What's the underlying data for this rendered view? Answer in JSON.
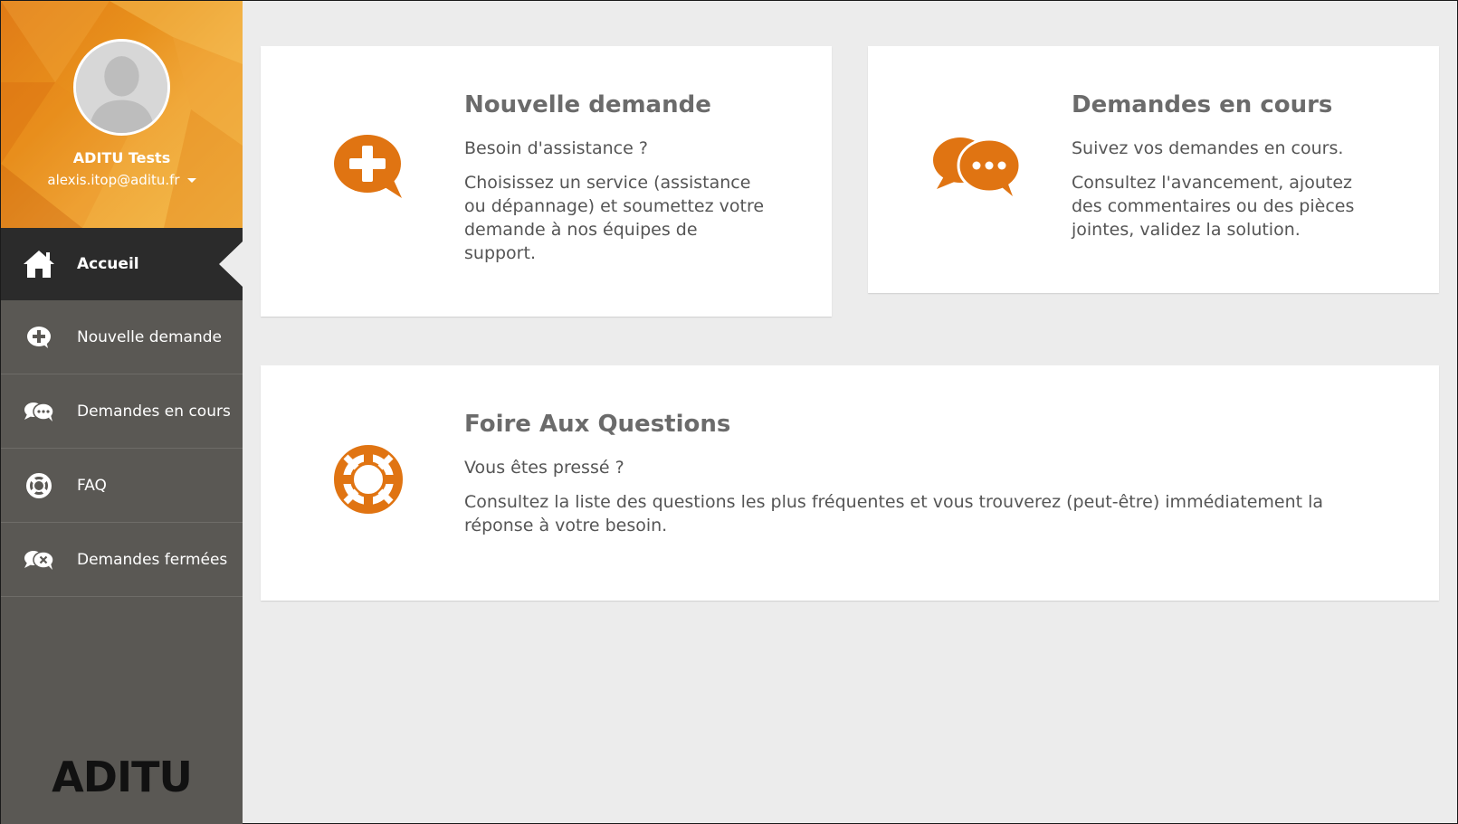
{
  "user": {
    "name": "ADITU Tests",
    "email": "alexis.itop@aditu.fr"
  },
  "sidebar": {
    "items": [
      {
        "label": "Accueil",
        "icon": "home-icon",
        "active": true
      },
      {
        "label": "Nouvelle demande",
        "icon": "plus-bubble-icon",
        "active": false
      },
      {
        "label": "Demandes en cours",
        "icon": "chat-bubbles-icon",
        "active": false
      },
      {
        "label": "FAQ",
        "icon": "lifebuoy-icon",
        "active": false
      },
      {
        "label": "Demandes fermées",
        "icon": "closed-bubbles-icon",
        "active": false
      }
    ],
    "logo": "ADITU"
  },
  "tiles": {
    "new_request": {
      "title": "Nouvelle demande",
      "subtitle": "Besoin d'assistance ?",
      "description": "Choisissez un service (assistance ou dépannage) et soumettez votre demande à nos équipes de support.",
      "icon": "plus-bubble-icon"
    },
    "ongoing": {
      "title": "Demandes en cours",
      "subtitle": "Suivez vos demandes en cours.",
      "description": "Consultez l'avancement, ajoutez des commentaires ou des pièces jointes, validez la solution.",
      "icon": "chat-bubbles-icon"
    },
    "faq": {
      "title": "Foire Aux Questions",
      "subtitle": "Vous êtes pressé ?",
      "description": "Consultez la liste des questions les plus fréquentes et vous trouverez (peut-être) immédiatement la réponse à votre besoin.",
      "icon": "lifebuoy-icon"
    }
  },
  "colors": {
    "accent": "#e07412",
    "sidebar": "#5a5854",
    "sidebar_active": "#2b2b2b",
    "background": "#ececec"
  }
}
